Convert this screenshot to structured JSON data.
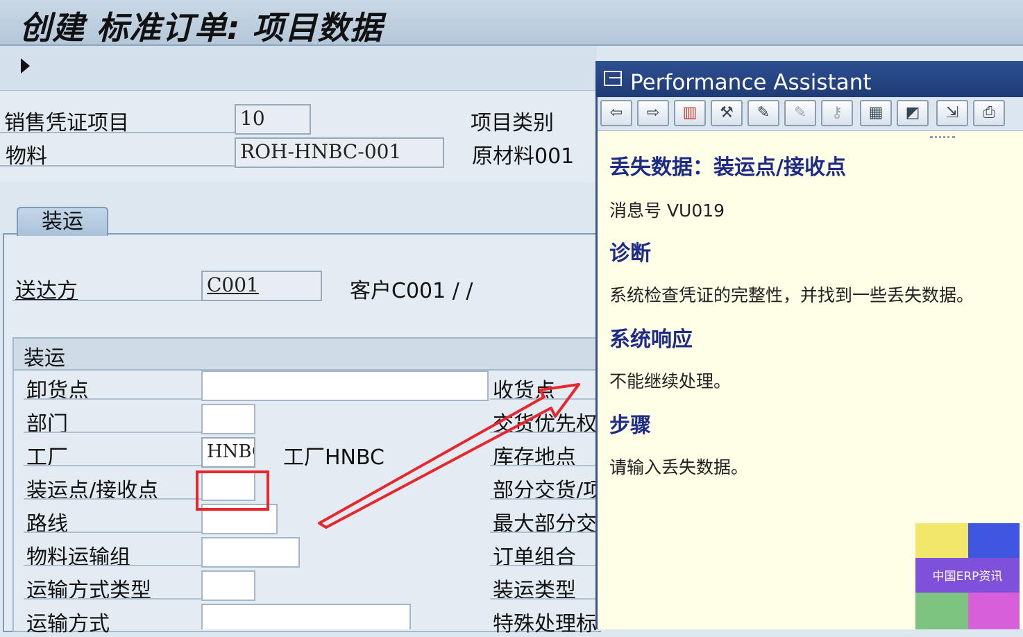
{
  "window": {
    "title": "创建 标准订单: 项目数据"
  },
  "header": {
    "item_label": "销售凭证项目",
    "item_value": "10",
    "material_label": "物料",
    "material_value": "ROH-HNBC-001",
    "item_category_label": "项目类别",
    "material_desc": "原材料001"
  },
  "tabs": [
    {
      "label": "装运"
    }
  ],
  "shipping": {
    "ship_to_label": "送达方",
    "ship_to_value": "C001",
    "ship_to_desc": "客户C001 / /",
    "group_title": "装运",
    "left_fields": [
      {
        "label": "卸货点",
        "value": ""
      },
      {
        "label": "部门",
        "value": ""
      },
      {
        "label": "工厂",
        "value": "HNBC",
        "desc": "工厂HNBC"
      },
      {
        "label": "装运点/接收点",
        "value": ""
      },
      {
        "label": "路线",
        "value": ""
      },
      {
        "label": "物料运输组",
        "value": ""
      },
      {
        "label": "运输方式类型",
        "value": ""
      },
      {
        "label": "运输方式",
        "value": ""
      }
    ],
    "right_labels": [
      "收货点",
      "交货优先权",
      "库存地点",
      "部分交货/项",
      "最大部分交",
      "订单组合",
      "装运类型",
      "特殊处理标"
    ]
  },
  "assistant": {
    "title": "Performance Assistant",
    "heading": "丢失数据：装运点/接收点",
    "message_no": "消息号 VU019",
    "diag_title": "诊断",
    "diag_text": "系统检查凭证的完整性，并找到一些丢失数据。",
    "resp_title": "系统响应",
    "resp_text": "不能继续处理。",
    "steps_title": "步骤",
    "steps_text": "请输入丢失数据。",
    "toolbar_icons": [
      "back-icon",
      "forward-icon",
      "book-icon",
      "tools-icon",
      "edit-icon",
      "edit-alt-icon",
      "user-key-icon",
      "layout-icon",
      "window-icon",
      "export-icon",
      "print-icon"
    ]
  },
  "watermark": {
    "text": "中国ERP资讯",
    "colors": [
      "#f2e76a",
      "#3f57e0",
      "#7f50d9",
      "#7cc47f",
      "#d75fd9"
    ]
  },
  "annotation": {
    "highlight_color": "#e8262d"
  }
}
